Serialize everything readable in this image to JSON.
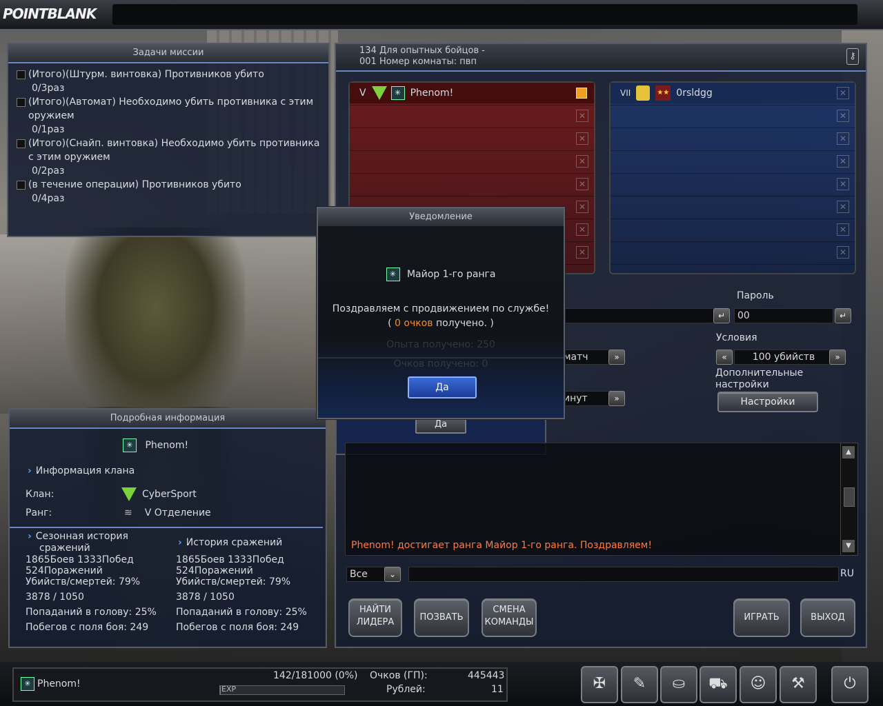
{
  "app": {
    "logo": "POINTBLANK"
  },
  "mission": {
    "title": "Задачи миссии",
    "items": [
      {
        "text": "(Итого)(Штурм. винтовка) Противников убито",
        "progress": "0/3раз"
      },
      {
        "text": "(Итого)(Автомат) Необходимо убить противника с этим оружием",
        "progress": "0/1раз"
      },
      {
        "text": "(Итого)(Снайп. винтовка) Необходимо убить противника с этим оружием",
        "progress": "0/2раз"
      },
      {
        "text": "(в течение операции) Противников убито",
        "progress": "0/4раз"
      }
    ]
  },
  "room": {
    "line1": "134 Для опытных бойцов -",
    "line2": "001 Номер комнаты: пвп",
    "key_icon": "key-icon",
    "red_team": {
      "rank": "V",
      "player": "Phenom!"
    },
    "blue_team": {
      "rank": "VII",
      "player": "0rsldgg"
    },
    "password_label": "Пароль",
    "password_value": "00",
    "conditions_label": "Условия",
    "conditions_value": "100 убийств",
    "mode_left_1": "матч",
    "mode_left_2": "инут",
    "extra_label_1": "Дополнительные",
    "extra_label_2": "настройки",
    "settings_button": "Настройки",
    "hidden_yes": "Да"
  },
  "chat": {
    "message": "Phenom! достигает ранга Майор 1-го ранга. Поздравляем!",
    "filter": "Все",
    "lang": "RU"
  },
  "actions": {
    "find_leader_1": "НАЙТИ",
    "find_leader_2": "ЛИДЕРА",
    "invite": "ПОЗВАТЬ",
    "change_team_1": "СМЕНА",
    "change_team_2": "КОМАНДЫ",
    "play": "ИГРАТЬ",
    "exit": "ВЫХОД"
  },
  "details": {
    "title": "Подробная информация",
    "player": "Phenom!",
    "clan_info": "Информация клана",
    "clan_label": "Клан:",
    "clan_value": "CyberSport",
    "rank_label": "Ранг:",
    "rank_value": "V Отделение",
    "season_title_1": "Сезонная история",
    "season_title_2": "сражений",
    "history_title": "История сражений",
    "season": {
      "line1": "1865Боев 1333Побед",
      "line2": "524Поражений",
      "line3": "Убийств/смертей: 79%",
      "line4": "3878 / 1050",
      "line5": "Попаданий в голову: 25%",
      "line6": "Побегов с поля боя: 249"
    },
    "history": {
      "line1": "1865Боев 1333Побед",
      "line2": "524Поражений",
      "line3": "Убийств/смертей: 79%",
      "line4": "3878 / 1050",
      "line5": "Попаданий в голову: 25%",
      "line6": "Побегов с поля боя: 249"
    }
  },
  "notification": {
    "title": "Уведомление",
    "rank": "Майор 1-го ранга",
    "line1": "Поздравляем с продвижением по службе!",
    "line2_open": "(",
    "line2_points": "0 очков",
    "line2_rest": "получено. )",
    "ghost1": "Опыта получено: 250",
    "ghost2": "Очков получено: 0",
    "ok": "Да"
  },
  "status": {
    "player": "Phenom!",
    "exp_value": "142/181000 (0%)",
    "exp_label": "EXP",
    "exp_fraction": 0.0008,
    "points_label": "Очков (ГП):",
    "points_value": "445443",
    "rubles_label": "Рублей:",
    "rubles_value": "11"
  },
  "colors": {
    "accent": "#6b86c8",
    "chat_highlight": "#ff7a3c",
    "points_highlight": "#ff8a1e"
  }
}
